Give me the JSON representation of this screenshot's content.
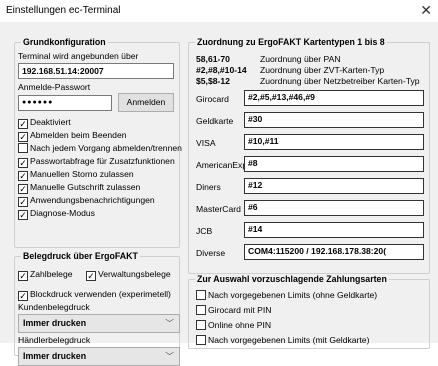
{
  "window": {
    "title": "Einstellungen ec-Terminal",
    "close_glyph": "✕"
  },
  "grundkonfiguration": {
    "title": "Grundkonfiguration",
    "terminal_label": "Terminal wird angebunden über",
    "terminal_value": "192.168.51.14:20007",
    "password_label": "Anmelde-Passwort",
    "password_value": "●●●●●●",
    "login_button": "Anmelden",
    "checkboxes": [
      {
        "label": "Deaktiviert",
        "checked": true
      },
      {
        "label": "Abmelden beim Beenden",
        "checked": true
      },
      {
        "label": "Nach jedem Vorgang abmelden/trennen",
        "checked": false
      },
      {
        "label": "Passwortabfrage für Zusatzfunktionen",
        "checked": true
      },
      {
        "label": "Manuellen Storno zulassen",
        "checked": true
      },
      {
        "label": "Manuelle Gutschrift zulassen",
        "checked": true
      },
      {
        "label": "Anwendungsbenachrichtigungen",
        "checked": true
      },
      {
        "label": "Diagnose-Modus",
        "checked": true
      }
    ]
  },
  "belegdruck": {
    "title": "Belegdruck über ErgoFAKT",
    "zahlbelege": {
      "label": "Zahlbelege",
      "checked": true
    },
    "verwaltungsbelege": {
      "label": "Verwaltungsbelege",
      "checked": true
    },
    "blockdruck": {
      "label": "Blockdruck verwenden (experimetell)",
      "checked": true
    },
    "kunden_label": "Kundenbelegdruck",
    "kunden_value": "Immer drucken",
    "haendler_label": "Händlerbelegdruck",
    "haendler_value": "Immer drucken"
  },
  "kartentypen": {
    "title": "Zuordnung zu ErgoFAKT Kartentypen 1 bis 8",
    "legend": [
      {
        "code": "58,61-70",
        "desc": "Zuordnung über PAN"
      },
      {
        "code": "#2,#8,#10-14",
        "desc": "Zuordnung über ZVT-Karten-Typ"
      },
      {
        "code": "$5,$8-12",
        "desc": "Zuordnung über Netzbetreiber Karten-Typ"
      }
    ],
    "rows": [
      {
        "name": "Girocard",
        "value": "#2,#5,#13,#46,#9"
      },
      {
        "name": "Geldkarte",
        "value": "#30"
      },
      {
        "name": "VISA",
        "value": "#10,#11"
      },
      {
        "name": "AmericanExpress",
        "value": "#8"
      },
      {
        "name": "Diners",
        "value": "#12"
      },
      {
        "name": "MasterCard",
        "value": "#6"
      },
      {
        "name": "JCB",
        "value": "#14"
      },
      {
        "name": "Diverse",
        "value": "COM4:115200 / 192.168.178.38:20("
      }
    ]
  },
  "zahlungsarten": {
    "title": "Zur Auswahl vorzuschlagende Zahlungsarten",
    "items": [
      {
        "label": "Nach vorgegebenen Limits (ohne Geldkarte)",
        "checked": false
      },
      {
        "label": "Girocard mit PIN",
        "checked": false
      },
      {
        "label": "Online ohne PIN",
        "checked": false
      },
      {
        "label": "Nach vorgegebenen Limits (mit Geldkarte)",
        "checked": false
      }
    ]
  },
  "colors": {
    "dialog_bg": "#f0f0f0",
    "select_bg": "#e6e6e6",
    "border": "#cfcfcf"
  }
}
